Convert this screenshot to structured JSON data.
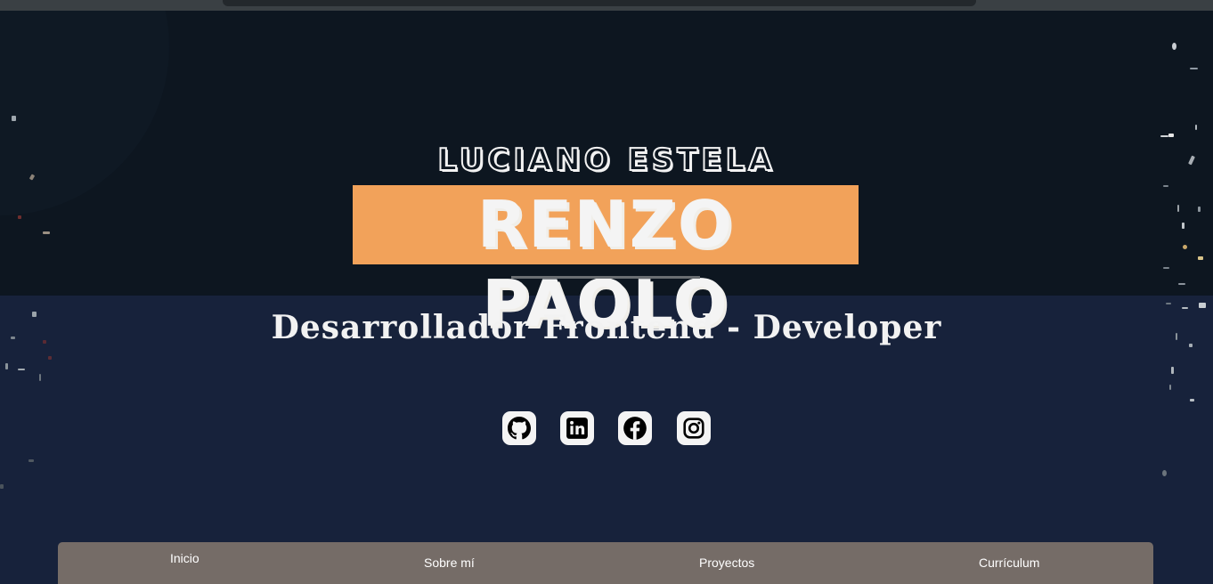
{
  "hero": {
    "first_name": "LUCIANO ESTELA",
    "last_name": "RENZO PAOLO",
    "role": "Desarrollador Frontend - Developer"
  },
  "social_links": [
    {
      "name": "GitHub",
      "icon": "github-icon"
    },
    {
      "name": "LinkedIn",
      "icon": "linkedin-icon"
    },
    {
      "name": "Facebook",
      "icon": "facebook-icon"
    },
    {
      "name": "Instagram",
      "icon": "instagram-icon"
    }
  ],
  "nav": {
    "items": [
      {
        "label": "Inicio"
      },
      {
        "label": "Sobre mí"
      },
      {
        "label": "Proyectos"
      },
      {
        "label": "Currículum"
      }
    ]
  },
  "colors": {
    "background_top": "#0d1620",
    "background_bottom": "#17223b",
    "accent": "#f2a25a",
    "navbar": "#756c67",
    "text": "#f2f2f2"
  }
}
